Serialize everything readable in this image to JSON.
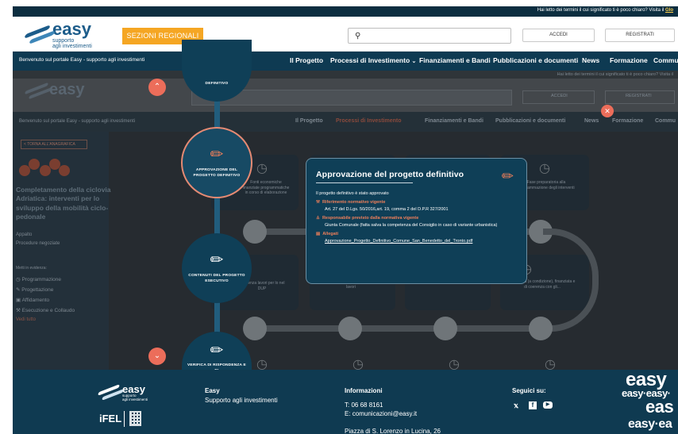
{
  "top_strip": {
    "tos_text": "Hai letto dei termini il cui significato ti è poco chiaro? Visita il ",
    "tos_link": "Glo"
  },
  "header": {
    "logo": {
      "word": "easy",
      "sub1": "supporto",
      "sub2": "agli investimenti"
    },
    "regional_button": "SEZIONI REGIONALI",
    "search_placeholder": "",
    "login_button": "ACCEDI",
    "register_button": "REGISTRATI"
  },
  "nav": {
    "welcome": "Benvenuto sul portale Easy - supporto agli investimenti",
    "items": [
      "Il Progetto",
      "Processi di Investimento",
      "Finanziamenti e Bandi",
      "Pubblicazioni e documenti",
      "News",
      "Formazione",
      "Commu"
    ]
  },
  "background": {
    "back_button": "< TORNA ALL'ANAGRAFICA",
    "project_title": "Completamento della ciclovia Adriatica: interventi per lo sviluppo della mobilità ciclo-pedonale",
    "tags": [
      "Appalto",
      "Procedure negoziate"
    ],
    "highlight_title": "Metti in evidenza:",
    "phases": [
      "Programmazione",
      "Progettazione",
      "Affidamento",
      "Esecuzione e Collaudo"
    ],
    "see_all": "Vedi tutto",
    "card_texts": [
      "Fonti economiche finanziate programmatiche in corso di elaborazione",
      "Fase preparatoria alla programmazione degli interventi",
      "Coerenza lavori per lo nel DUP",
      "lavori",
      "Coerenza (a condizione), finanziata e di coerenza con gli..."
    ]
  },
  "timeline": {
    "steps": [
      {
        "label": "DEFINITIVO"
      },
      {
        "label": "APPROVAZIONE DEL PROGETTO DEFINITIVO"
      },
      {
        "label": "CONTENUTI DEL PROGETTO ESECUTIVO"
      },
      {
        "label": "VERIFICA DI RISPONDENZA E DI"
      }
    ]
  },
  "popup": {
    "title": "Approvazione del progetto definitivo",
    "status": "Il progetto definitivo è stato approvato",
    "norm_title": "Riferimento normativo vigente",
    "norm_text": "Art. 27 del D.Lgs. 50/2016,art. 19, comma 2 del D.P.R 327/2001",
    "resp_title": "Responsabile previsto dalla normativa vigente",
    "resp_text": "Giunta Comunale (fatta salva la competenza del Consiglio in caso di variante urbanistica)",
    "attach_title": "Allegati",
    "attach_link": "Approvazione_Progetto_Definitivo_Comune_San_Benedetto_del_Tronto.pdf"
  },
  "footer": {
    "brand": "Easy",
    "brand_sub": "Supporto agli investimenti",
    "info_title": "Informazioni",
    "phone": "T: 06 68 8161",
    "email": "E: comunicazioni@easy.it",
    "address": "Piazza di S. Lorenzo in Lucina, 26",
    "follow": "Seguici su:",
    "ifel": "iFEL",
    "big_brand_1": "easy",
    "big_brand_2": "easy·easy·",
    "big_brand_3": "eas",
    "big_brand_4": "easy·ea"
  },
  "colors": {
    "primary": "#0f3f57",
    "accent": "#f07f5a",
    "regional": "#f5a623",
    "overlay": "#262b30"
  }
}
